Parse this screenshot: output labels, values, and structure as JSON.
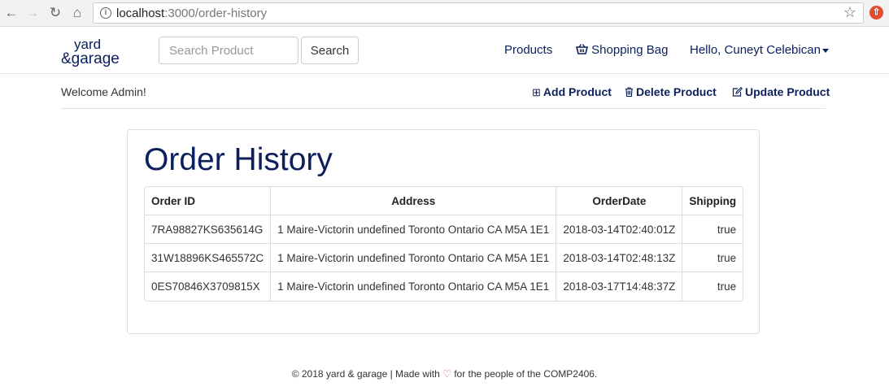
{
  "browser": {
    "url_host": "localhost",
    "url_path": ":3000/order-history"
  },
  "header": {
    "logo_line1": "yard",
    "logo_line2": "&garage",
    "search_placeholder": "Search Product",
    "search_button": "Search",
    "nav": {
      "products": "Products",
      "shopping_bag": "Shopping Bag",
      "user_greeting": "Hello, Cuneyt Celebican"
    }
  },
  "admin_bar": {
    "welcome": "Welcome Admin!",
    "add_product": "Add Product",
    "delete_product": "Delete Product",
    "update_product": "Update Product"
  },
  "main": {
    "title": "Order History",
    "columns": [
      "Order ID",
      "Address",
      "OrderDate",
      "Shipping"
    ],
    "rows": [
      [
        "7RA98827KS635614G",
        "1 Maire-Victorin undefined Toronto Ontario CA M5A 1E1",
        "2018-03-14T02:40:01Z",
        "true"
      ],
      [
        "31W18896KS465572C",
        "1 Maire-Victorin undefined Toronto Ontario CA M5A 1E1",
        "2018-03-14T02:48:13Z",
        "true"
      ],
      [
        "0ES70846X3709815X",
        "1 Maire-Victorin undefined Toronto Ontario CA M5A 1E1",
        "2018-03-17T14:48:37Z",
        "true"
      ]
    ]
  },
  "footer": {
    "before": "© 2018 yard & garage | Made with",
    "after": "for the people of the COMP2406."
  },
  "colors": {
    "brand": "#0b1f5c",
    "heart": "#d9534f",
    "extension": "#e34c2e"
  }
}
